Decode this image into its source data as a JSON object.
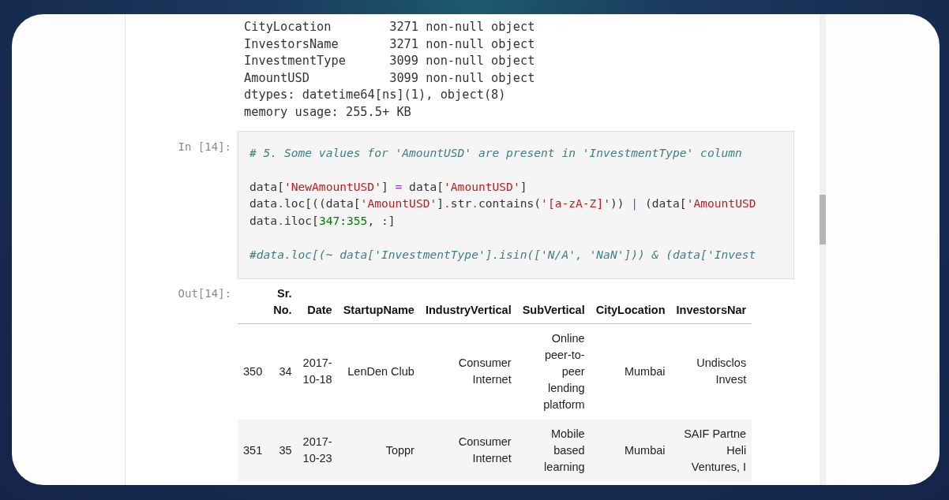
{
  "info_output": {
    "lines": [
      "CityLocation        3271 non-null object",
      "InvestorsName       3271 non-null object",
      "InvestmentType      3099 non-null object",
      "AmountUSD           3099 non-null object",
      "dtypes: datetime64[ns](1), object(8)",
      "memory usage: 255.5+ KB"
    ]
  },
  "input_cell": {
    "prompt": "In [14]:",
    "lines": [
      {
        "kind": "code",
        "tokens": [
          {
            "kind": "comment",
            "text": "# 5. Some values for 'AmountUSD' are present in 'InvestmentType' column"
          }
        ]
      },
      {
        "kind": "blank"
      },
      {
        "kind": "code",
        "tokens": [
          {
            "kind": "name",
            "text": "data["
          },
          {
            "kind": "string",
            "text": "'NewAmountUSD'"
          },
          {
            "kind": "name",
            "text": "] "
          },
          {
            "kind": "op",
            "text": "="
          },
          {
            "kind": "name",
            "text": " data["
          },
          {
            "kind": "string",
            "text": "'AmountUSD'"
          },
          {
            "kind": "name",
            "text": "]"
          }
        ]
      },
      {
        "kind": "code",
        "tokens": [
          {
            "kind": "name",
            "text": "data"
          },
          {
            "kind": "op",
            "text": "."
          },
          {
            "kind": "name",
            "text": "loc[((data["
          },
          {
            "kind": "string",
            "text": "'AmountUSD'"
          },
          {
            "kind": "name",
            "text": "]"
          },
          {
            "kind": "op",
            "text": "."
          },
          {
            "kind": "name",
            "text": "str"
          },
          {
            "kind": "op",
            "text": "."
          },
          {
            "kind": "name",
            "text": "contains("
          },
          {
            "kind": "string",
            "text": "'[a-zA-Z]'"
          },
          {
            "kind": "name",
            "text": ")) "
          },
          {
            "kind": "op",
            "text": "|"
          },
          {
            "kind": "name",
            "text": " (data["
          },
          {
            "kind": "string",
            "text": "'AmountUSD"
          }
        ]
      },
      {
        "kind": "code",
        "tokens": [
          {
            "kind": "name",
            "text": "data"
          },
          {
            "kind": "op",
            "text": "."
          },
          {
            "kind": "name",
            "text": "iloc["
          },
          {
            "kind": "number",
            "text": "347"
          },
          {
            "kind": "name",
            "text": ":"
          },
          {
            "kind": "number",
            "text": "355"
          },
          {
            "kind": "name",
            "text": ", :]"
          }
        ]
      },
      {
        "kind": "blank"
      },
      {
        "kind": "code",
        "tokens": [
          {
            "kind": "comment",
            "text": "#data.loc[(~ data['InvestmentType'].isin(['N/A', 'NaN'])) & (data['Invest"
          }
        ]
      }
    ]
  },
  "output_cell": {
    "prompt": "Out[14]:",
    "table": {
      "columns": [
        "Sr.\nNo.",
        "Date",
        "StartupName",
        "IndustryVertical",
        "SubVertical",
        "CityLocation",
        "InvestorsNar"
      ],
      "rows": [
        {
          "index": "350",
          "cells": [
            "34",
            "2017-\n10-18",
            "LenDen Club",
            "Consumer\nInternet",
            "Online\npeer-to-\npeer\nlending\nplatform",
            "Mumbai",
            "Undisclos\nInvest"
          ]
        },
        {
          "index": "351",
          "cells": [
            "35",
            "2017-\n10-23",
            "Toppr",
            "Consumer\nInternet",
            "Mobile\nbased\nlearning",
            "Mumbai",
            "SAIF Partne\nHeli\nVentures, I"
          ]
        }
      ]
    }
  }
}
